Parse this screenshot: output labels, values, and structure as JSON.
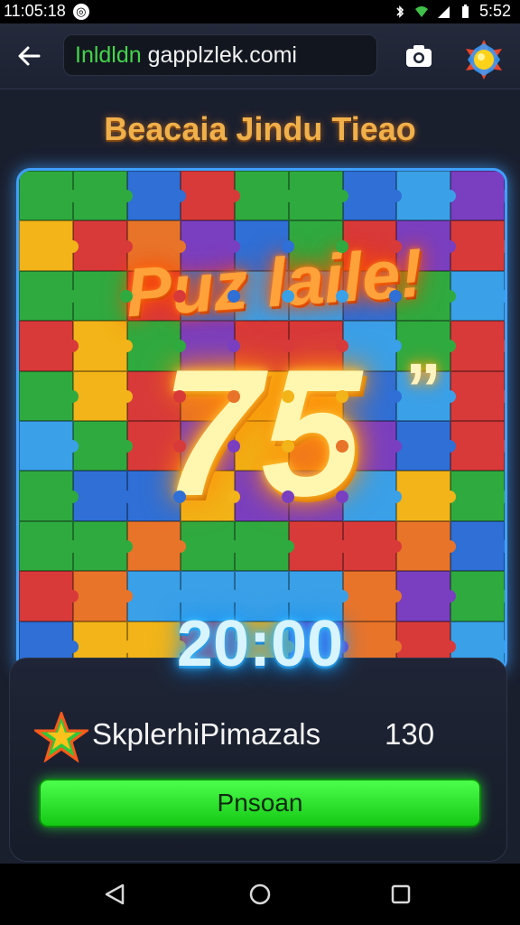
{
  "status_bar": {
    "time_left": "11:05:18",
    "time_right": "5:52",
    "icons": [
      "notification-badge-icon",
      "bluetooth-icon",
      "wifi-icon",
      "signal-icon",
      "battery-icon"
    ]
  },
  "app_bar": {
    "url_green": "Inldldn",
    "url_white": "gapplzlek.comi",
    "icons": [
      "back-arrow-icon",
      "camera-icon",
      "sun-icon"
    ]
  },
  "game": {
    "title": "Beacaia Jindu Tieao",
    "banner": "Puz laile!",
    "big_number": "75",
    "quote": "”",
    "timer": "20:00"
  },
  "panel": {
    "player_name": "SkplerhiPimazals",
    "score": "130",
    "button_label": "Pnsoan"
  },
  "colors": {
    "accent_orange": "#f0b04a",
    "timer_glow": "#42c8ff",
    "button_green": "#22dd22",
    "board_border": "#3fa0ff"
  },
  "navigation": {
    "icons": [
      "back-triangle-icon",
      "home-circle-icon",
      "recents-square-icon"
    ]
  }
}
